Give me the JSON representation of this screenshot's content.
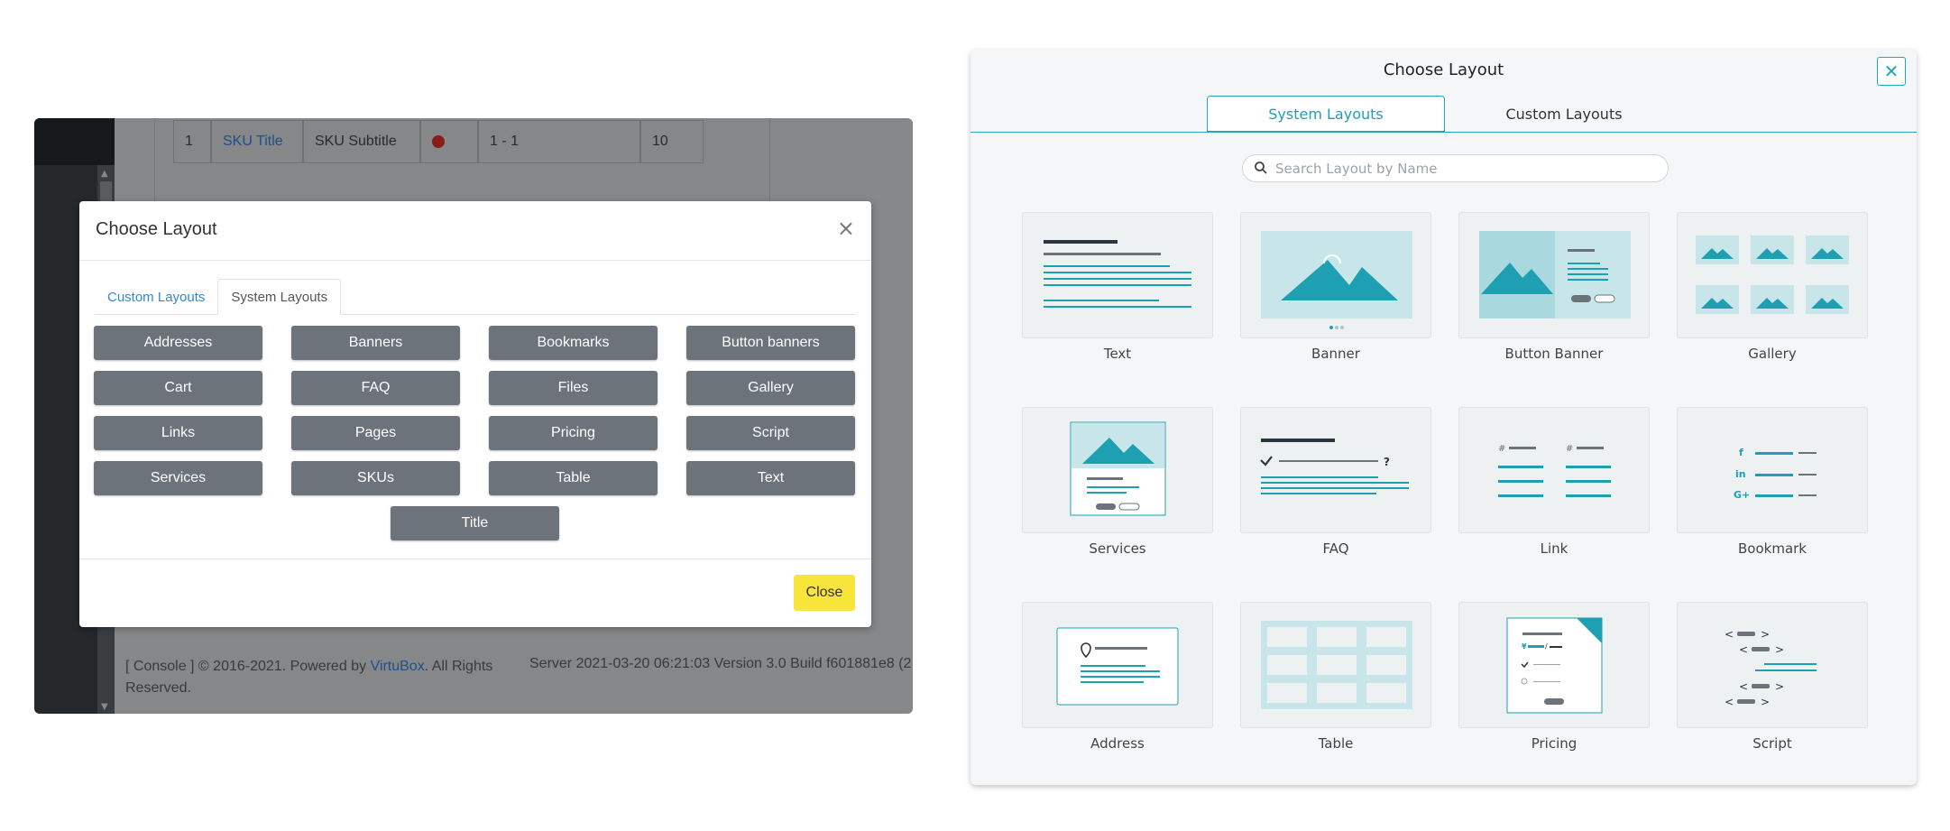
{
  "left_screenshot": {
    "table_row": {
      "num": "1",
      "title": "SKU Title",
      "subtitle": "SKU Subtitle",
      "range": "1 - 1",
      "qty": "10"
    },
    "footer_text": "[ Console ] © 2016-2021. Powered by ",
    "footer_link": "VirtuBox",
    "footer_suffix": ". All Rights Reserved.",
    "server_text": "Server 2021-03-20 06:21:03 Version 3.0 Build f601881e8 (2"
  },
  "modal_left": {
    "title": "Choose Layout",
    "close_icon": "×",
    "tabs": [
      "Custom Layouts",
      "System Layouts"
    ],
    "buttons": [
      "Addresses",
      "Banners",
      "Bookmarks",
      "Button banners",
      "Cart",
      "FAQ",
      "Files",
      "Gallery",
      "Links",
      "Pages",
      "Pricing",
      "Script",
      "Services",
      "SKUs",
      "Table",
      "Text",
      "Title"
    ],
    "close_button": "Close",
    "close_button_color": "#f8e53c"
  },
  "right_panel": {
    "title": "Choose Layout",
    "close_icon": "✕",
    "tabs": {
      "system": "System Layouts",
      "custom": "Custom Layouts"
    },
    "search_placeholder": "Search Layout by Name",
    "accent_color": "#23a6b8",
    "layouts": [
      "Text",
      "Banner",
      "Button Banner",
      "Gallery",
      "Services",
      "FAQ",
      "Link",
      "Bookmark",
      "Address",
      "Table",
      "Pricing",
      "Script"
    ]
  }
}
